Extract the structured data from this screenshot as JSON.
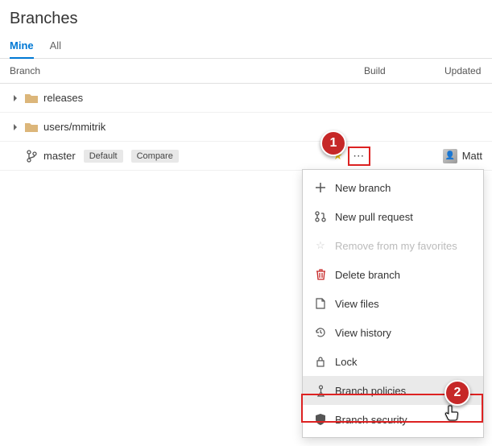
{
  "page": {
    "title": "Branches"
  },
  "tabs": [
    {
      "label": "Mine",
      "active": true
    },
    {
      "label": "All",
      "active": false
    }
  ],
  "columns": {
    "branch": "Branch",
    "build": "Build",
    "updated": "Updated"
  },
  "rows": {
    "folder1": {
      "name": "releases"
    },
    "folder2": {
      "name": "users/mmitrik"
    },
    "master": {
      "name": "master",
      "default_badge": "Default",
      "compare_badge": "Compare",
      "user": "Matt"
    }
  },
  "menu": {
    "new_branch": "New branch",
    "new_pr": "New pull request",
    "remove_fav": "Remove from my favorites",
    "delete": "Delete branch",
    "view_files": "View files",
    "view_history": "View history",
    "lock": "Lock",
    "policies": "Branch policies",
    "security": "Branch security"
  },
  "callouts": {
    "c1": "1",
    "c2": "2"
  }
}
